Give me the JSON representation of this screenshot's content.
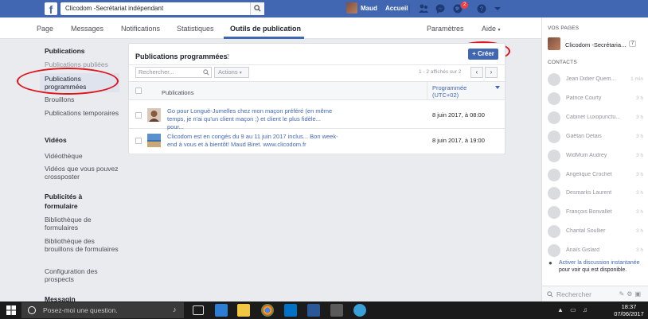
{
  "topbar": {
    "logo": "f",
    "search_value": "Clicodom -Secrétariat indépendant",
    "user_name": "Maud",
    "home_label": "Accueil",
    "notifications_count": "2"
  },
  "page_nav": {
    "tabs": [
      "Page",
      "Messages",
      "Notifications",
      "Statistiques",
      "Outils de publication"
    ],
    "active_tab": "Outils de publication",
    "settings_label": "Paramètres",
    "help_label": "Aide"
  },
  "sidebar": {
    "sections": [
      {
        "title": "Publications",
        "items": [
          "Publications publiées",
          "Publications programmées",
          "Brouillons",
          "Publications temporaires"
        ]
      },
      {
        "title": "Vidéos",
        "items": [
          "Vidéothèque",
          "Vidéos que vous pouvez crossposter"
        ]
      },
      {
        "title": "Publicités à formulaire",
        "items": [
          "Bibliothèque de formulaires",
          "Bibliothèque des brouillons de formulaires",
          "Configuration des prospects"
        ]
      },
      {
        "title": "Messagin"
      }
    ],
    "selected_item": "Publications programmées"
  },
  "main": {
    "title": "Publications programmées",
    "count": "2",
    "create_label": "+ Créer",
    "search_placeholder": "Rechercher...",
    "actions_label": "Actions",
    "pagination_info": "1 - 2 affichés sur 2",
    "columns": {
      "publications": "Publications",
      "scheduled": "Programmée (UTC+02)"
    },
    "rows": [
      {
        "text": "Go pour Longué-Jumelles chez mon maçon préféré (en même temps, je n'ai qu'un client maçon ;) et client le plus fidèle... pour...",
        "date": "8 juin 2017, à 08:00"
      },
      {
        "text": "Clicodom est en congés du 9 au 11 juin 2017 inclus... Bon week-end à vous et à bientôt! Maud Biret. www.clicodom.fr",
        "date": "8 juin 2017, à 19:00"
      }
    ]
  },
  "right_column": {
    "pages_header": "VOS PAGES",
    "page_name": "Clicodom -Secrétaria...",
    "page_count": "7",
    "contacts_header": "CONTACTS",
    "contacts": [
      {
        "name": "Jean Didier Quem...",
        "time": "1 min"
      },
      {
        "name": "Patrice Courty",
        "time": "3 h"
      },
      {
        "name": "Cabinet Luxopunctu...",
        "time": "3 h"
      },
      {
        "name": "Gaëtan Detais",
        "time": "3 h"
      },
      {
        "name": "WidMum Audrey",
        "time": "3 h"
      },
      {
        "name": "Angelique Crochet",
        "time": "3 h"
      },
      {
        "name": "Desmarks Laurent",
        "time": "3 h"
      },
      {
        "name": "François Bonvallet",
        "time": "3 h"
      },
      {
        "name": "Chantal Soullier",
        "time": "3 h"
      },
      {
        "name": "Anaïs Gislard",
        "time": "3 h"
      }
    ],
    "active_link": "Activer la discussion instantanée",
    "active_text": " pour voir qui est disponible.",
    "search_placeholder": "Rechercher"
  },
  "taskbar": {
    "search_placeholder": "Posez-moi une question.",
    "time": "18:37",
    "date": "07/06/2017"
  },
  "colors": {
    "brand": "#4267b2",
    "annotation": "#e0131b",
    "badge": "#fa3e3e"
  }
}
